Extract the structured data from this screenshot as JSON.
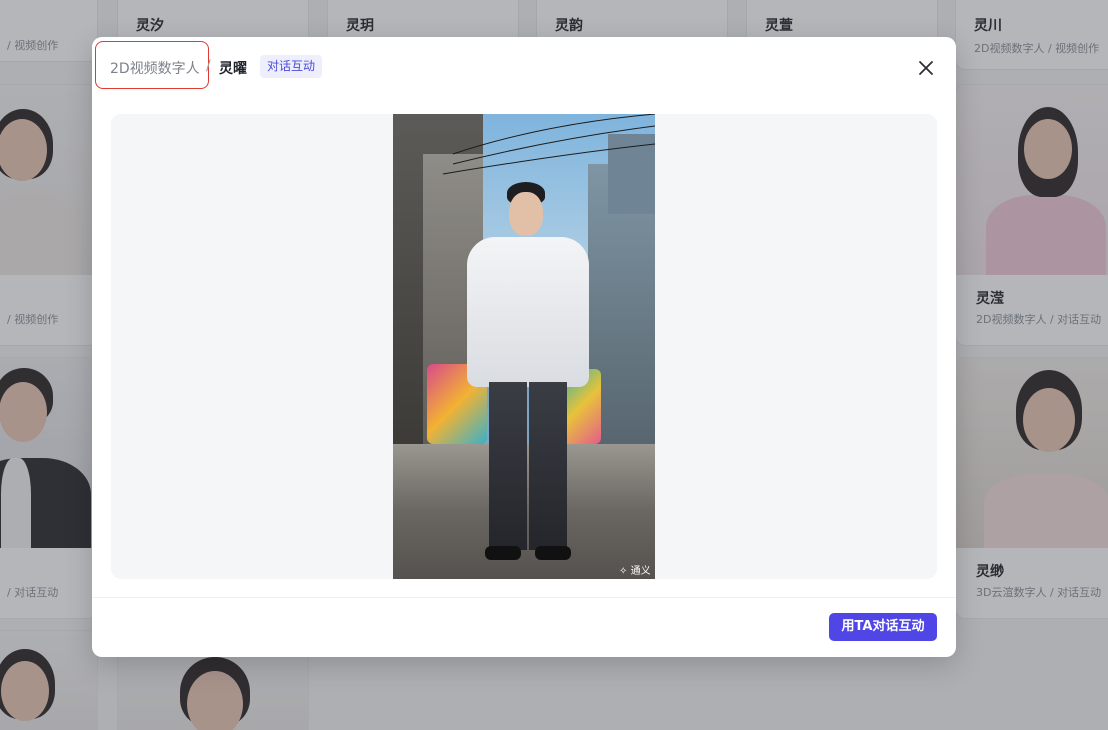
{
  "gallery": {
    "cards": [
      {
        "name": "灵汐",
        "sub": ""
      },
      {
        "name": "灵玥",
        "sub": ""
      },
      {
        "name": "灵韵",
        "sub": ""
      },
      {
        "name": "灵萱",
        "sub": ""
      },
      {
        "name": "灵川",
        "sub": "2D视频数字人 / 视频创作"
      },
      {
        "name": "灵滢",
        "sub": "2D视频数字人 / 对话互动"
      },
      {
        "name": "灵缈",
        "sub": "3D云渲数字人 / 对话互动"
      }
    ],
    "left_subs": [
      "/ 视频创作",
      "/ 视频创作",
      "/ 对话互动"
    ]
  },
  "modal": {
    "breadcrumb_parent": "2D视频数字人",
    "breadcrumb_separator": "/",
    "breadcrumb_current": "灵曜",
    "tag": "对话互动",
    "watermark": "通义",
    "cta_label": "用TA对话互动"
  },
  "colors": {
    "accent": "#4f46e5",
    "tag_bg": "#eeeefd",
    "highlight": "#e0392f"
  },
  "icons": {
    "close": "close-icon",
    "watermark_logo": "tongyi-logo-icon"
  }
}
